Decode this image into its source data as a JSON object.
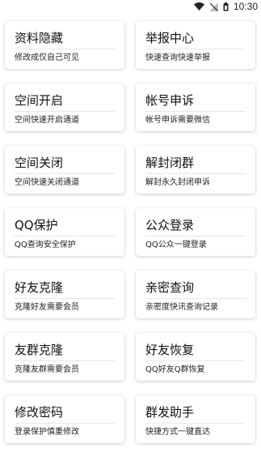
{
  "status_bar": {
    "time": "10:30",
    "icons": [
      "wifi-icon",
      "no-signal-icon",
      "battery-icon"
    ]
  },
  "cards": [
    {
      "title": "资料隐藏",
      "subtitle": "修改成仅自己可见"
    },
    {
      "title": "举报中心",
      "subtitle": "快速查询快速举报"
    },
    {
      "title": "空间开启",
      "subtitle": "空间快速开启通道"
    },
    {
      "title": "帐号申诉",
      "subtitle": "帐号申诉需要微信"
    },
    {
      "title": "空间关闭",
      "subtitle": "空间快速关闭通道"
    },
    {
      "title": "解封闭群",
      "subtitle": "解封永久封闭申诉"
    },
    {
      "title": "QQ保护",
      "subtitle": "QQ查询安全保护"
    },
    {
      "title": "公众登录",
      "subtitle": "QQ公众一键登录"
    },
    {
      "title": "好友克隆",
      "subtitle": "克隆好友需要会员"
    },
    {
      "title": "亲密查询",
      "subtitle": "亲密度快讯查询记录"
    },
    {
      "title": "友群克隆",
      "subtitle": "克隆友群需要会员"
    },
    {
      "title": "好友恢复",
      "subtitle": "QQ好友Q群恢复"
    },
    {
      "title": "修改密码",
      "subtitle": "登录保护慎重修改"
    },
    {
      "title": "群发助手",
      "subtitle": "快捷方式一键直达"
    }
  ]
}
